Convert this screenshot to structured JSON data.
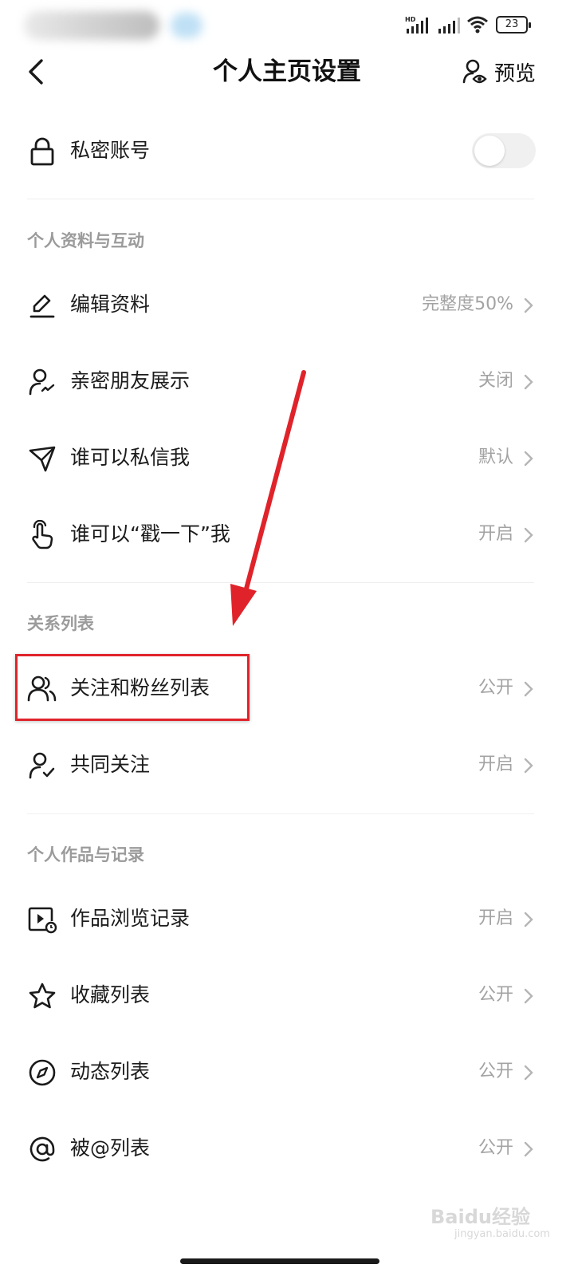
{
  "status_bar": {
    "battery": "23",
    "network_label": "HD"
  },
  "header": {
    "title": "个人主页设置",
    "preview_label": "预览"
  },
  "private_account": {
    "label": "私密账号",
    "enabled": false
  },
  "sections": {
    "profile": {
      "title": "个人资料与互动",
      "items": [
        {
          "label": "编辑资料",
          "value": "完整度50%",
          "icon": "edit-icon"
        },
        {
          "label": "亲密朋友展示",
          "value": "关闭",
          "icon": "close-friend-icon"
        },
        {
          "label": "谁可以私信我",
          "value": "默认",
          "icon": "send-icon"
        },
        {
          "label": "谁可以“戳一下”我",
          "value": "开启",
          "icon": "poke-hand-icon"
        }
      ]
    },
    "relations": {
      "title": "关系列表",
      "items": [
        {
          "label": "关注和粉丝列表",
          "value": "公开",
          "icon": "users-icon"
        },
        {
          "label": "共同关注",
          "value": "开启",
          "icon": "user-check-icon"
        }
      ]
    },
    "works": {
      "title": "个人作品与记录",
      "items": [
        {
          "label": "作品浏览记录",
          "value": "开启",
          "icon": "video-history-icon"
        },
        {
          "label": "收藏列表",
          "value": "公开",
          "icon": "star-icon"
        },
        {
          "label": "动态列表",
          "value": "公开",
          "icon": "compass-icon"
        },
        {
          "label": "被@列表",
          "value": "公开",
          "icon": "at-icon"
        }
      ]
    }
  },
  "watermark": {
    "text": "Baidu经验",
    "sub": "jingyan.baidu.com"
  },
  "colors": {
    "annotation_red": "#e0232a",
    "value_gray": "#a3a3a3",
    "section_gray": "#9b9b9b"
  }
}
